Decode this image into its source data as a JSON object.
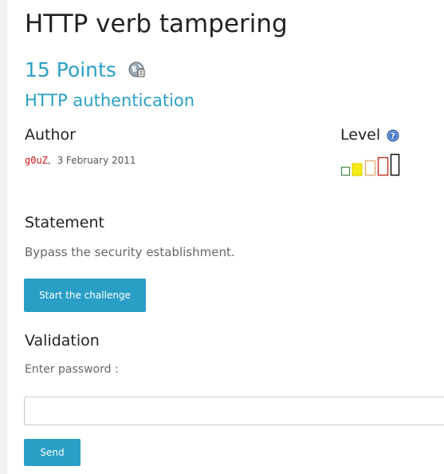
{
  "challenge": {
    "title": "HTTP verb tampering",
    "points": "15 Points",
    "category": "HTTP authentication"
  },
  "author": {
    "heading": "Author",
    "name": "g0uZ",
    "separator": ",",
    "date": "3 February 2011"
  },
  "level": {
    "heading": "Level",
    "current": 2,
    "max": 5,
    "icon": "help-icon"
  },
  "statement": {
    "heading": "Statement",
    "text": "Bypass the security establishment.",
    "start_label": "Start the challenge"
  },
  "validation": {
    "heading": "Validation",
    "password_label": "Enter password :",
    "password_value": "",
    "send_label": "Send"
  },
  "colors": {
    "accent": "#2a9fc6",
    "author_name": "#cc1111",
    "level_1": "#2e7d32",
    "level_2": "#f5ea14",
    "level_3": "#e0b27a",
    "level_4": "#c0392b",
    "level_5": "#111111"
  }
}
